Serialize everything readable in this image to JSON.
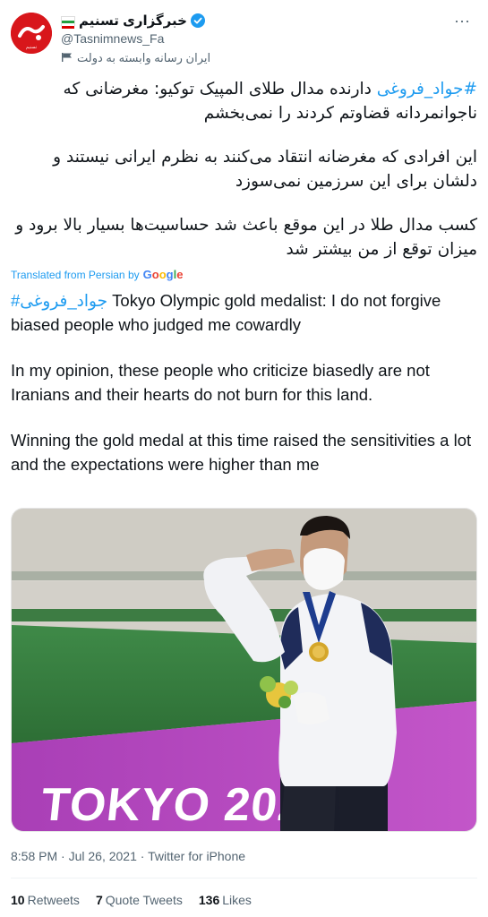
{
  "account": {
    "display_name": "خبرگزاری تسنیم",
    "handle": "@Tasnimnews_Fa",
    "affiliation": "ایران رسانه وابسته به دولت",
    "avatar_text": "تسنیم",
    "verified_icon": "verified-badge-icon",
    "flag_icon": "iran-flag-icon"
  },
  "tweet": {
    "persian_hashtag": "#جواد_فروغی",
    "persian_line1_rest": " دارنده مدال طلای المپیک توکیو: مغرضانی که ناجوانمردانه قضاوتم کردند را نمی‌بخشم",
    "persian_para2": "این افرادی که مغرضانه انتقاد می‌کنند به نظرم ایرانی نیستند و دلشان برای این سرزمین نمی‌سوزد",
    "persian_para3": "کسب مدال طلا در این موقع باعث شد حساسیت‌ها  بسیار بالا برود و میزان توقع از من بیشتر شد",
    "translated_label": "Translated from Persian by",
    "google_letters": [
      "G",
      "o",
      "o",
      "g",
      "l",
      "e"
    ],
    "english_hashtag": "#جواد_فروغی",
    "english_para1_rest": " Tokyo Olympic gold medalist: I do not forgive biased people who judged me cowardly",
    "english_para2": "In my opinion, these people who criticize biasedly are not Iranians and their hearts do not burn for this land.",
    "english_para3": "Winning the gold medal at this time raised the sensitivities a lot and the expectations were higher than me"
  },
  "photo": {
    "banner_text": "TOKYO 2020"
  },
  "meta": {
    "time": "8:58 PM",
    "date": "Jul 26, 2021",
    "source": "Twitter for iPhone"
  },
  "stats": {
    "retweets_count": "10",
    "retweets_label": "Retweets",
    "quotes_count": "7",
    "quotes_label": "Quote Tweets",
    "likes_count": "136",
    "likes_label": "Likes"
  },
  "colors": {
    "accent": "#1d9bf0",
    "avatar_red": "#d8161b",
    "muted": "#536471"
  }
}
